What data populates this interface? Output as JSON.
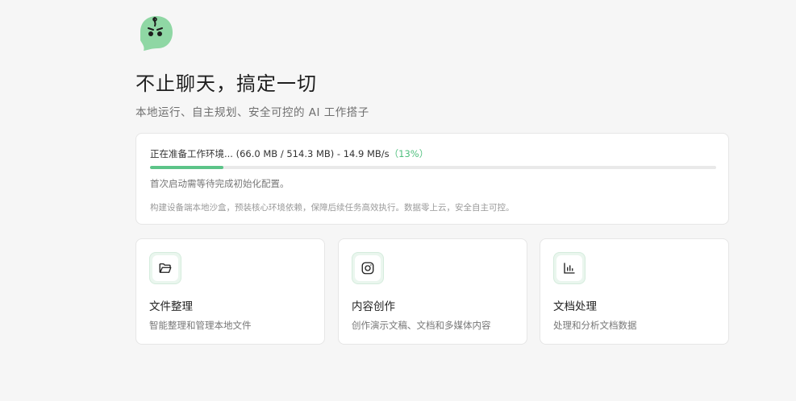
{
  "brand": {
    "logo_icon": "green-ghost-mascot-icon",
    "accent_color": "#5cc488"
  },
  "hero": {
    "headline": "不止聊天，搞定一切",
    "subline": "本地运行、自主规划、安全可控的 AI 工作搭子"
  },
  "progress": {
    "status_text": "正在准备工作环境... (66.0 MB / 514.3 MB) - 14.9 MB/s",
    "percent_text": "（13%）",
    "percent": 13,
    "hint": "首次启动需等待完成初始化配置。",
    "description": "构建设备端本地沙盒，预装核心环境依赖，保障后续任务高效执行。数据零上云，安全自主可控。"
  },
  "features": [
    {
      "icon": "folder-open-icon",
      "title": "文件整理",
      "desc": "智能整理和管理本地文件"
    },
    {
      "icon": "camera-square-icon",
      "title": "内容创作",
      "desc": "创作演示文稿、文档和多媒体内容"
    },
    {
      "icon": "bar-chart-icon",
      "title": "文档处理",
      "desc": "处理和分析文档数据"
    }
  ]
}
